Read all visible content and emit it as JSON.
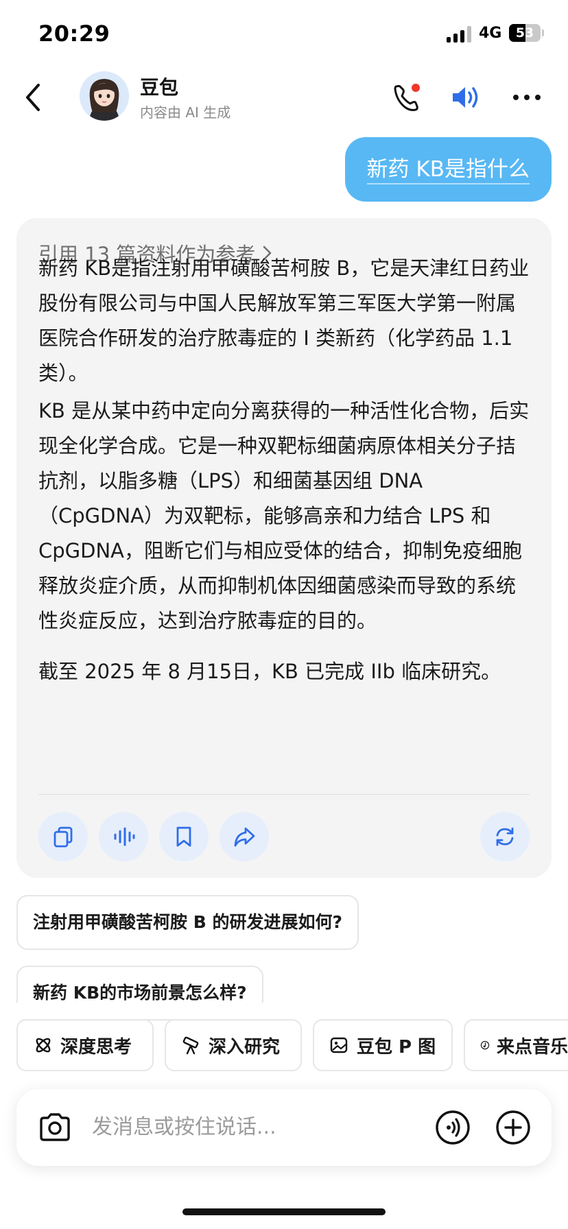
{
  "status": {
    "time": "20:29",
    "network": "4G",
    "battery": "53",
    "battery_level": 0.53
  },
  "header": {
    "title": "豆包",
    "subtitle": "内容由 AI 生成",
    "icons": [
      "back-icon",
      "avatar",
      "phone-icon",
      "speaker-icon",
      "more-icon"
    ],
    "notification_dot_color": "#f0352b",
    "accent_color": "#2f6ee8"
  },
  "user_message": "新药 KB是指什么",
  "answer": {
    "reference_label": "引用 13 篇资料作为参考",
    "paragraphs": [
      "新药 KB是指注射用甲磺酸苦柯胺 B，它是天津红日药业股份有限公司与中国人民解放军第三军医大学第一附属医院合作研发的治疗脓毒症的 I 类新药（化学药品 1.1类）。",
      "KB 是从某中药中定向分离获得的一种活性化合物，后实现全化学合成。它是一种双靶标细菌病原体相关分子拮抗剂，以脂多糖（LPS）和细菌基因组 DNA（CpGDNA）为双靶标，能够高亲和力结合 LPS 和 CpGDNA，阻断它们与相应受体的结合，抑制免疫细胞释放炎症介质，从而抑制机体因细菌感染而导致的系统性炎症反应，达到治疗脓毒症的目的。",
      "截至 2025 年 8 月15日，KB 已完成 IIb 临床研究。"
    ],
    "actions": [
      "copy-icon",
      "voice-read-icon",
      "bookmark-icon",
      "share-icon",
      "regenerate-icon"
    ]
  },
  "suggestions": [
    "注射用甲磺酸苦柯胺 B 的研发进展如何?",
    "新药 KB的市场前景怎么样?"
  ],
  "tools": [
    {
      "label": "深度思考",
      "icon": "atom-icon"
    },
    {
      "label": "深入研究",
      "icon": "telescope-icon"
    },
    {
      "label": "豆包 P 图",
      "icon": "image-edit-icon"
    },
    {
      "label": "来点音乐",
      "icon": "music-icon"
    }
  ],
  "input": {
    "placeholder": "发消息或按住说话..."
  }
}
